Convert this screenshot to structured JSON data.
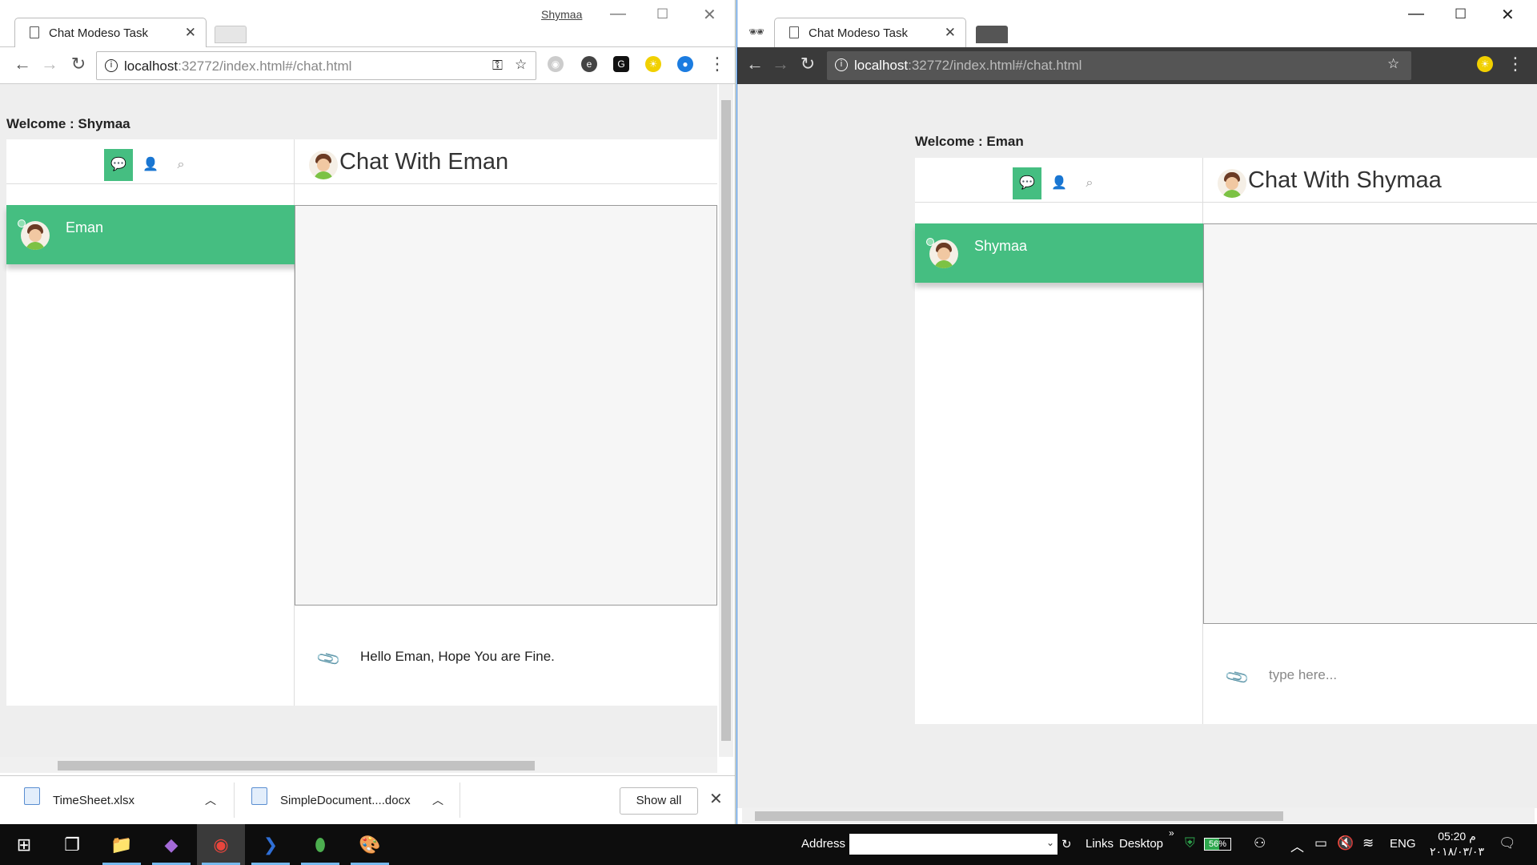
{
  "left_window": {
    "profile_name": "Shymaa",
    "tab_title": "Chat Modeso Task",
    "url_host": "localhost",
    "url_rest": ":32772/index.html#/chat.html",
    "welcome": "Welcome : Shymaa",
    "chat_title": "Chat With Eman",
    "contact_name": "Eman",
    "composer_text": "Hello Eman, Hope You are Fine.",
    "downloads": [
      {
        "name": "TimeSheet.xlsx"
      },
      {
        "name": "SimpleDocument....docx"
      }
    ],
    "show_all": "Show all"
  },
  "right_window": {
    "tab_title": "Chat Modeso Task",
    "url_host": "localhost",
    "url_rest": ":32772/index.html#/chat.html",
    "welcome": "Welcome : Eman",
    "chat_title": "Chat With Shymaa",
    "contact_name": "Shymaa",
    "composer_placeholder": "type here..."
  },
  "taskbar": {
    "address_label": "Address",
    "links": "Links",
    "desktop": "Desktop",
    "battery": "56%",
    "language": "ENG",
    "time": "05:20 م",
    "date": "٢٠١٨/٠٣/٠٣"
  },
  "colors": {
    "accent": "#45be81",
    "taskbar": "#0d0d0d",
    "incognito_toolbar": "#3a3a3a"
  }
}
